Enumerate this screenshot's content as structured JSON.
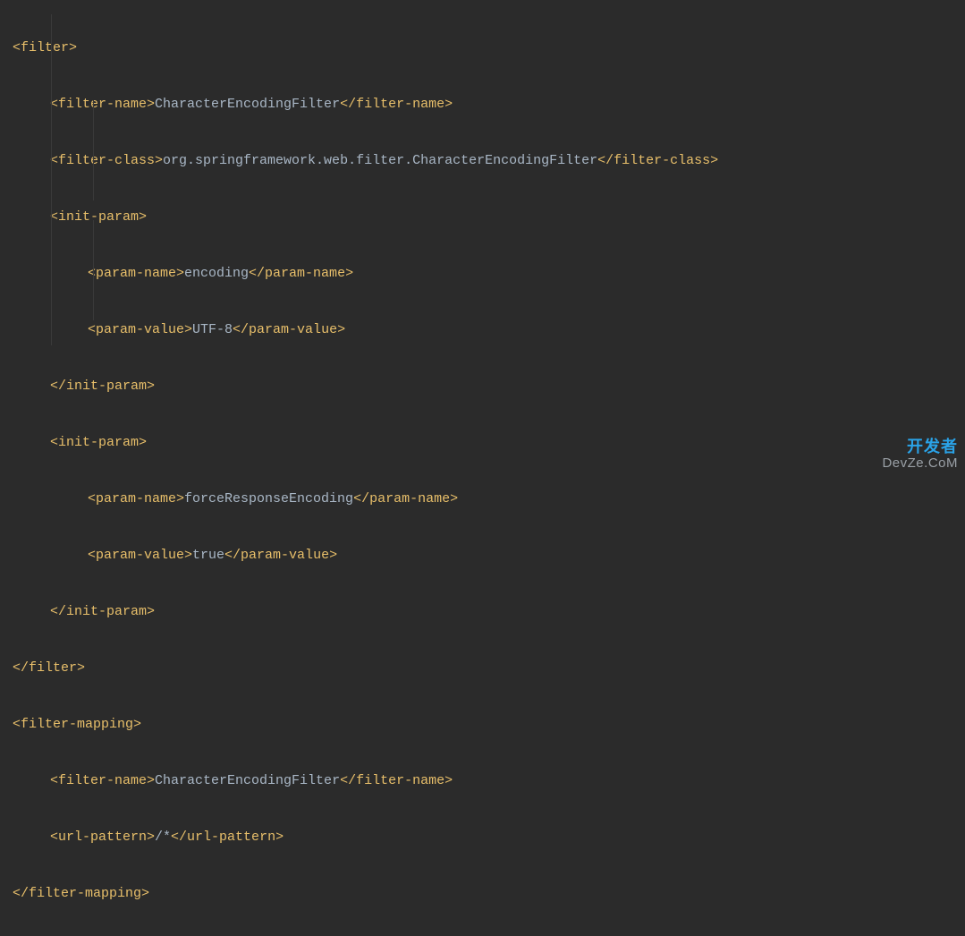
{
  "code": {
    "l0": {
      "open": "<filter>",
      "close": ""
    },
    "l1": {
      "open": "<filter-name>",
      "text": "CharacterEncodingFilter",
      "close": "</filter-name>"
    },
    "l2": {
      "open": "<filter-class>",
      "text": "org.springframework.web.filter.CharacterEncodingFilter",
      "close": "</filter-class>"
    },
    "l3": {
      "open": "<init-param>",
      "close": ""
    },
    "l4": {
      "open": "<param-name>",
      "text": "encoding",
      "close": "</param-name>"
    },
    "l5": {
      "open": "<param-value>",
      "text": "UTF-8",
      "close": "</param-value>"
    },
    "l6": {
      "open": "</init-param>",
      "close": ""
    },
    "l7": {
      "open": "<init-param>",
      "close": ""
    },
    "l8": {
      "open": "<param-name>",
      "text": "forceResponseEncoding",
      "close": "</param-name>"
    },
    "l9": {
      "open": "<param-value>",
      "text": "true",
      "close": "</param-value>"
    },
    "l10": {
      "open": "</init-param>",
      "close": ""
    },
    "l11": {
      "open": "</filter>",
      "close": ""
    },
    "l12": {
      "open": "<filter-mapping>",
      "close": ""
    },
    "l13": {
      "open": "<filter-name>",
      "text": "CharacterEncodingFilter",
      "close": "</filter-name>"
    },
    "l14": {
      "open": "<url-pattern>",
      "text": "/*",
      "close": "</url-pattern>"
    },
    "l15": {
      "open": "</filter-mapping>",
      "close": ""
    }
  },
  "watermark": {
    "top": "开发者",
    "bot": "DevZe.CoM"
  }
}
